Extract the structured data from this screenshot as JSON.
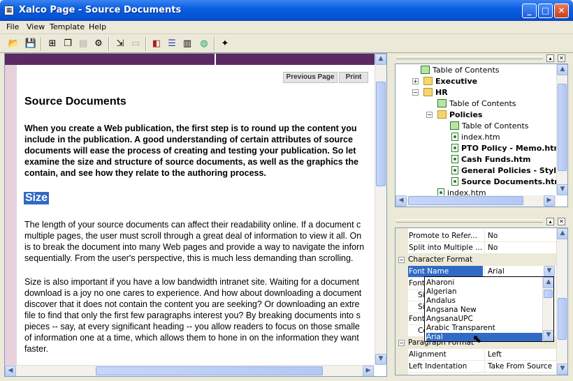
{
  "window": {
    "title": "Xalco Page - Source Documents",
    "minimize": "_",
    "maximize": "□",
    "close": "✕"
  },
  "menu": [
    "File",
    "View",
    "Template",
    "Help"
  ],
  "toolbar_icons": [
    "open-icon",
    "save-icon",
    "tree-icon",
    "copy-icon",
    "paste-icon",
    "network-icon",
    "import-icon",
    "export-icon",
    "bookmark-icon",
    "list-icon",
    "layout-icon",
    "globe-icon",
    "wand-icon"
  ],
  "document": {
    "nav_prev": "Previous Page",
    "nav_print": "Print",
    "title": "Source Documents",
    "intro": [
      "When you create a Web publication, the first step is to round up the content you",
      "include in the publication. A good understanding of certain attributes of source",
      "documents will ease the process of creating and testing your publication. So let",
      "examine the size and structure of source documents, as well as the graphics the",
      "contain, and see how they relate to the authoring process."
    ],
    "heading_size": "Size",
    "para1": [
      "The length of your source documents can affect their readability online. If a document c",
      "multiple pages, the user must scroll through a great deal of information to view it all. On",
      "is to break the document into many Web pages and provide a way to navigate the inforn",
      "sequentially. From the user's perspective, this is much less demanding than scrolling."
    ],
    "para2": [
      "Size is also important if you have a low bandwidth intranet site. Waiting for a document",
      "download is a joy no one cares to experience. And how about downloading a document",
      "discover that it does not contain the content you are seeking? Or downloading an extre",
      "file to find that only the first few paragraphs interest you? By breaking documents into s",
      "pieces -- say, at every significant heading -- you allow readers to focus on those smalle",
      "of information one at a time, which allows them to hone in on the information they want",
      "faster."
    ]
  },
  "tree": [
    {
      "label": "Table of Contents",
      "bold": false,
      "icon": "toc"
    },
    {
      "label": "Executive",
      "bold": true,
      "icon": "folder",
      "expander": "+"
    },
    {
      "label": "HR",
      "bold": true,
      "icon": "folder",
      "expander": "−"
    },
    {
      "label": "Table of Contents",
      "bold": false,
      "icon": "toc"
    },
    {
      "label": "Policies",
      "bold": true,
      "icon": "folder",
      "expander": "−"
    },
    {
      "label": "Table of Contents",
      "bold": false,
      "icon": "toc"
    },
    {
      "label": "index.htm",
      "bold": false,
      "icon": "doc"
    },
    {
      "label": "PTO Policy - Memo.htm",
      "bold": true,
      "icon": "doc"
    },
    {
      "label": "Cash Funds.htm",
      "bold": true,
      "icon": "doc"
    },
    {
      "label": "General Policies - Styles",
      "bold": true,
      "icon": "doc"
    },
    {
      "label": "Source Documents.htm",
      "bold": true,
      "icon": "doc"
    },
    {
      "label": "index.htm",
      "bold": false,
      "icon": "doc"
    }
  ],
  "properties": {
    "rows_top": [
      {
        "name": "Promote to Refer...",
        "value": "No"
      },
      {
        "name": "Split into Multiple ...",
        "value": "No"
      }
    ],
    "category_char": "Character Format",
    "font_name_label": "Font Name",
    "font_name_value": "Arial",
    "partial_rows": [
      "Font",
      "Si",
      "Si",
      "Font",
      "Co"
    ],
    "category_para": "Paragraph Format",
    "rows_bottom": [
      {
        "name": "Alignment",
        "value": "Left"
      },
      {
        "name": "Left Indentation",
        "value": "Take From Source"
      }
    ]
  },
  "font_dropdown": {
    "options": [
      "Aharoni",
      "Algerian",
      "Andalus",
      "Angsana New",
      "AngsanaUPC",
      "Arabic Transparent",
      "Arial"
    ],
    "selected": "Arial"
  },
  "colors": {
    "titlebar": "#0453d5",
    "purple_band": "#5b2a63",
    "selection": "#316ac5",
    "stripe": "#e8d0dc"
  }
}
